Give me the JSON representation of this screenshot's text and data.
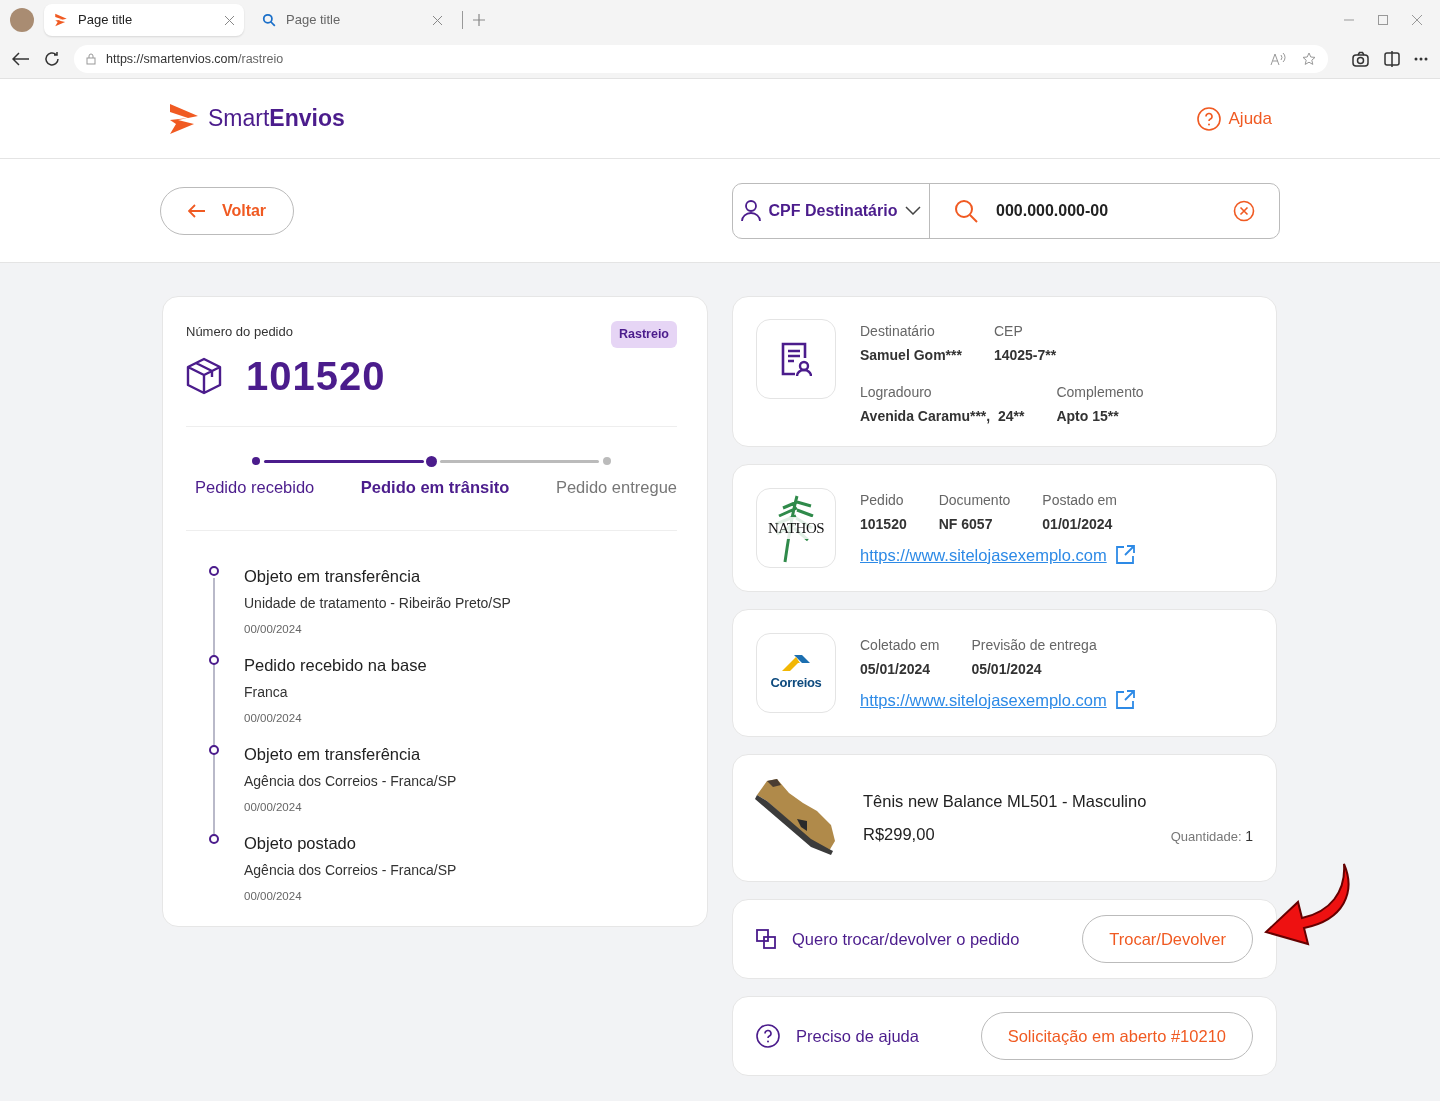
{
  "browser": {
    "tabs": [
      {
        "title": "Page title",
        "selected": true,
        "kind": "brand"
      },
      {
        "title": "Page title",
        "selected": false,
        "kind": "search"
      }
    ],
    "url_host": "https://smartenvios.com",
    "url_path": "/rastreio"
  },
  "header": {
    "logo": "Smart**Envios**",
    "help": "Ajuda"
  },
  "toolbar": {
    "back": "Voltar",
    "search_type": "CPF Destinatário",
    "search_value": "000.000.000-00"
  },
  "order": {
    "label": "Número do pedido",
    "badge": "Rastreio",
    "number": "101520",
    "steps": [
      {
        "label": "Pedido recebido",
        "completed": true,
        "selected": false
      },
      {
        "label": "Pedido em trânsito",
        "completed": true,
        "selected": true
      },
      {
        "label": "Pedido entregue",
        "completed": false,
        "selected": false
      }
    ],
    "events": [
      {
        "title": "Objeto em transferência",
        "place": "Unidade de tratamento - Ribeirão Preto/SP",
        "date": "00/00/2024"
      },
      {
        "title": "Pedido recebido na base",
        "place": "Franca",
        "date": "00/00/2024"
      },
      {
        "title": "Objeto em transferência",
        "place": "Agência dos Correios - Franca/SP",
        "date": "00/00/2024"
      },
      {
        "title": "Objeto postado",
        "place": "Agência dos Correios - Franca/SP",
        "date": "00/00/2024"
      }
    ]
  },
  "recipient": {
    "rows": [
      [
        {
          "label": "Destinatário",
          "value": "Samuel Gom***"
        },
        {
          "label": "CEP",
          "value": "14025-7**"
        }
      ],
      [
        {
          "label": "Logradouro",
          "value": "Avenida Caramu***,  24**"
        },
        {
          "label": "Complemento",
          "value": "Apto 15**"
        }
      ]
    ]
  },
  "store": {
    "logo": "NATHOS",
    "fields": [
      {
        "label": "Pedido",
        "value": "101520"
      },
      {
        "label": "Documento",
        "value": "NF 6057"
      },
      {
        "label": "Postado em",
        "value": "01/01/2024"
      }
    ],
    "link": "https://www.sitelojasexemplo.com"
  },
  "carrier": {
    "logo": "Correios",
    "fields": [
      {
        "label": "Coletado em",
        "value": "05/01/2024"
      },
      {
        "label": "Previsão de entrega",
        "value": "05/01/2024"
      }
    ],
    "link": "https://www.sitelojasexemplo.com"
  },
  "product": {
    "name": "Tênis new Balance ML501 - Masculino",
    "price": "R$299,00",
    "qty_label": "Quantidade:",
    "qty": "1"
  },
  "exchange": {
    "text": "Quero trocar/devolver o pedido",
    "button": "Trocar/Devolver"
  },
  "support": {
    "text": "Preciso de ajuda",
    "button": "Solicitação em aberto #10210"
  }
}
